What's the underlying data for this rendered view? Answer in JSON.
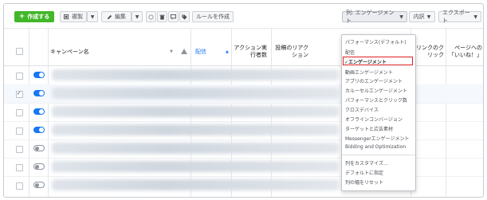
{
  "toolbar": {
    "create_label": "作成する",
    "duplicate_label": "複製",
    "edit_label": "編集",
    "rule_label": "ルールを作成",
    "view_label": "列: エンゲージメント",
    "breakdown_label": "内訳",
    "export_label": "エクスポート"
  },
  "table": {
    "headers": {
      "name": "キャンペーン名",
      "delivery": "配信",
      "actions": "アクション実行者数",
      "engagement": "投稿のリアクション",
      "link_clicks": "リンクのクリック",
      "page_likes": "ページへの「いいね！」"
    },
    "rows": [
      {
        "status": "on",
        "selected": false
      },
      {
        "status": "on",
        "selected": true
      },
      {
        "status": "on",
        "selected": false
      },
      {
        "status": "on",
        "selected": false
      },
      {
        "status": "off",
        "selected": false
      },
      {
        "status": "off",
        "selected": false
      },
      {
        "status": "off",
        "selected": false
      }
    ]
  },
  "menu": {
    "items": [
      {
        "label": "パフォーマンス(デフォルト)"
      },
      {
        "label": "配信"
      },
      {
        "label": "エンゲージメント",
        "active": true
      },
      {
        "label": "動画エンゲージメント"
      },
      {
        "label": "アプリのエンゲージメント"
      },
      {
        "label": "カルーセルエンゲージメント"
      },
      {
        "label": "パフォーマンスとクリック数"
      },
      {
        "label": "クロスデバイス"
      },
      {
        "label": "オフラインコンバージョン"
      },
      {
        "label": "ターゲットと広告素材"
      },
      {
        "label": "Messengerエンゲージメント"
      },
      {
        "label": "Bidding and Optimization"
      }
    ],
    "footer_items": [
      {
        "label": "列をカスタマイズ..."
      },
      {
        "label": "デフォルトに指定"
      },
      {
        "label": "列の幅をリセット"
      }
    ],
    "checkmark": "✓"
  },
  "colors": {
    "accent_green": "#42b72a",
    "accent_blue": "#1877f2",
    "highlight_red": "#e02020"
  }
}
